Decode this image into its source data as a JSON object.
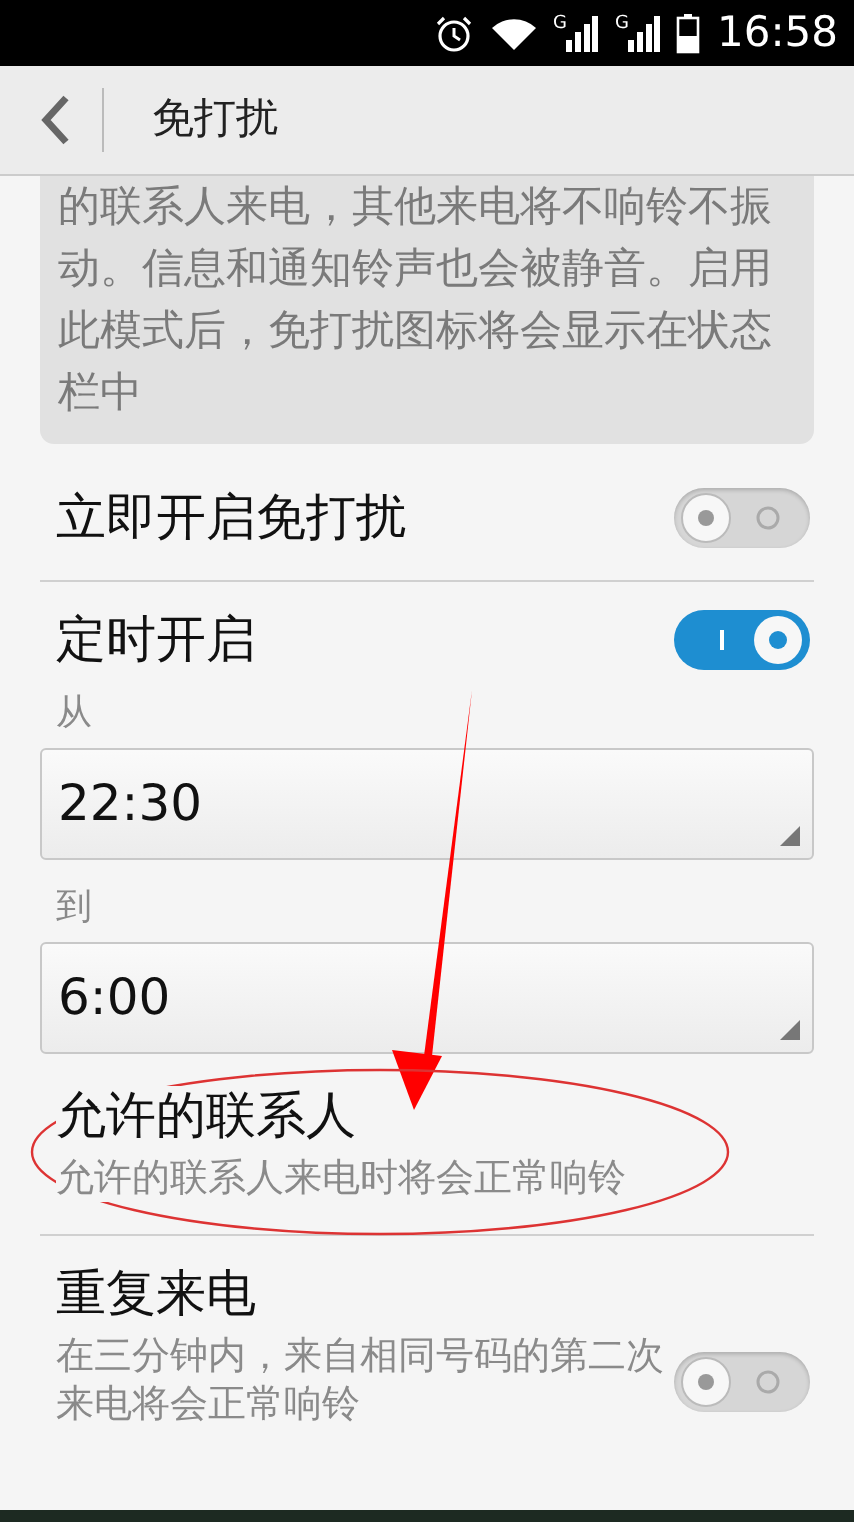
{
  "status_bar": {
    "networks": [
      "G",
      "G"
    ],
    "time": "16:58"
  },
  "header": {
    "title": "免打扰"
  },
  "intro": "的联系人来电，其他来电将不响铃不振动。信息和通知铃声也会被静音。启用此模式后，免打扰图标将会显示在状态栏中",
  "settings": [
    {
      "kind": "toggle",
      "title": "立即开启免打扰",
      "on": false
    },
    {
      "kind": "toggle",
      "title": "定时开启",
      "on": true
    },
    {
      "kind": "picker",
      "label": "从",
      "value": "22:30"
    },
    {
      "kind": "picker",
      "label": "到",
      "value": "6:00"
    },
    {
      "kind": "link",
      "title": "允许的联系人",
      "subtitle": "允许的联系人来电时将会正常响铃"
    },
    {
      "kind": "toggle",
      "title": "重复来电",
      "subtitle": "在三分钟内，来自相同号码的第二次来电将会正常响铃",
      "on": false
    }
  ]
}
